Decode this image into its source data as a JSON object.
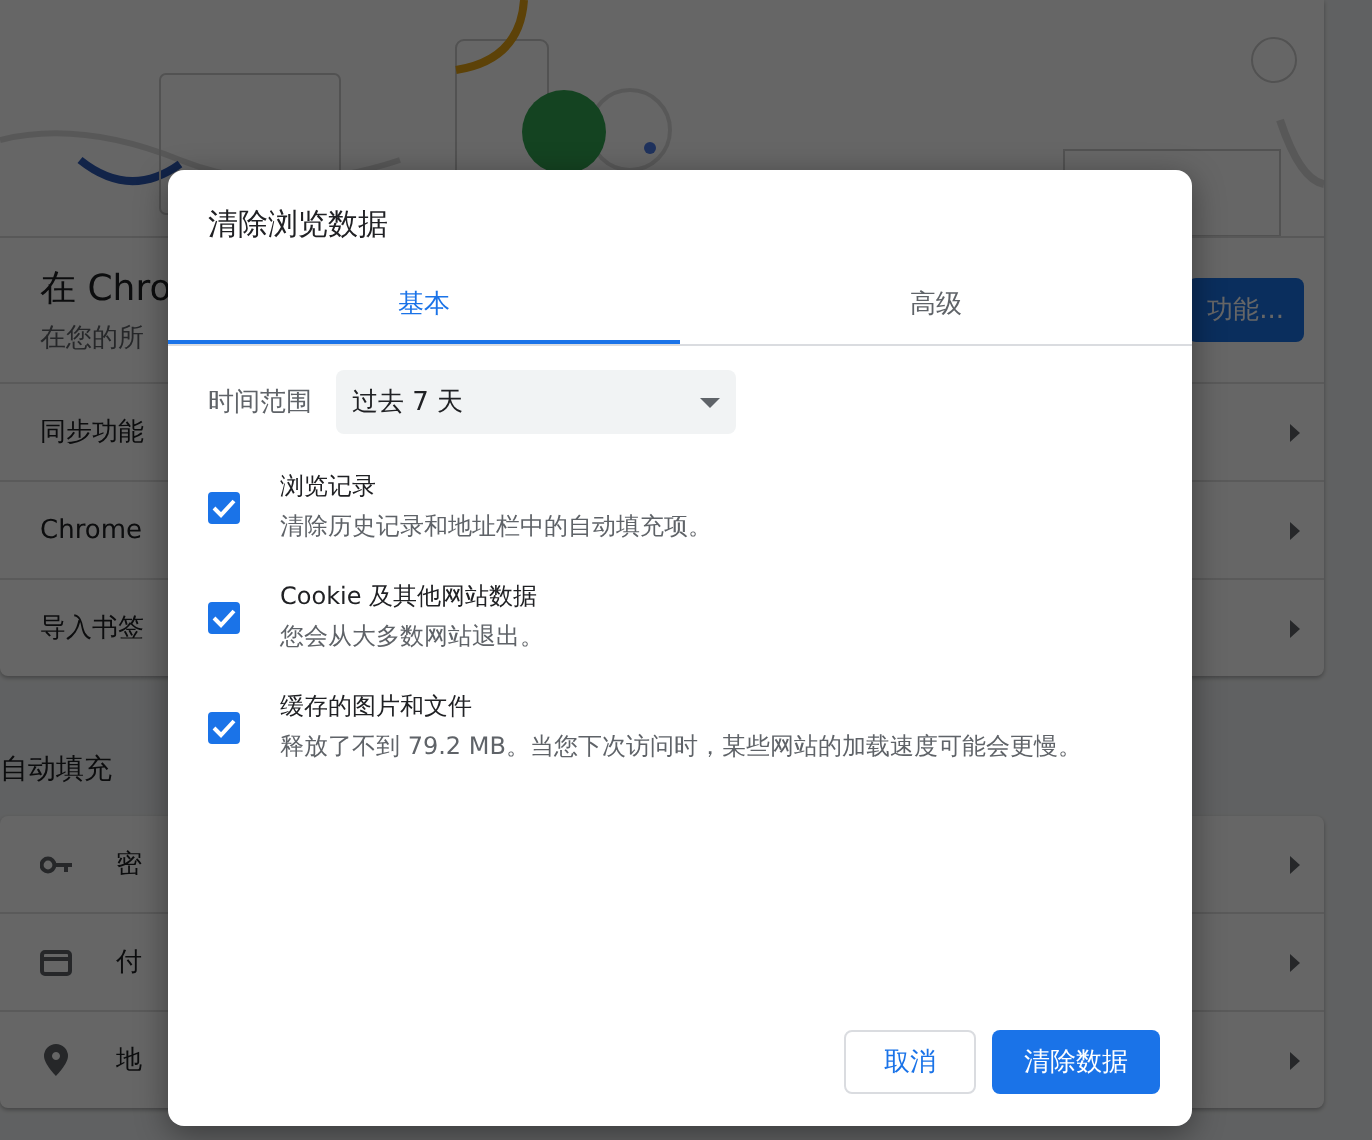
{
  "page": {
    "header": {
      "title": "在 Chro",
      "subtitle": "在您的所",
      "button": "功能..."
    },
    "rows": [
      {
        "label": "同步功能"
      },
      {
        "label": "Chrome"
      },
      {
        "label": "导入书签"
      }
    ],
    "autofill": {
      "heading": "自动填充",
      "rows": [
        {
          "kind": "key",
          "label": "密"
        },
        {
          "kind": "card",
          "label": "付"
        },
        {
          "kind": "pin",
          "label": "地"
        }
      ]
    }
  },
  "dialog": {
    "title": "清除浏览数据",
    "tabs": [
      {
        "label": "基本",
        "selected": true
      },
      {
        "label": "高级",
        "selected": false
      }
    ],
    "time_range": {
      "label": "时间范围",
      "value": "过去 7 天"
    },
    "options": [
      {
        "title": "浏览记录",
        "description": "清除历史记录和地址栏中的自动填充项。",
        "checked": true
      },
      {
        "title": "Cookie 及其他网站数据",
        "description": "您会从大多数网站退出。",
        "checked": true
      },
      {
        "title": "缓存的图片和文件",
        "description": "释放了不到 79.2 MB。当您下次访问时，某些网站的加载速度可能会更慢。",
        "checked": true
      }
    ],
    "buttons": [
      {
        "kind": "secondary",
        "label": "取消"
      },
      {
        "kind": "primary",
        "label": "清除数据"
      }
    ]
  }
}
